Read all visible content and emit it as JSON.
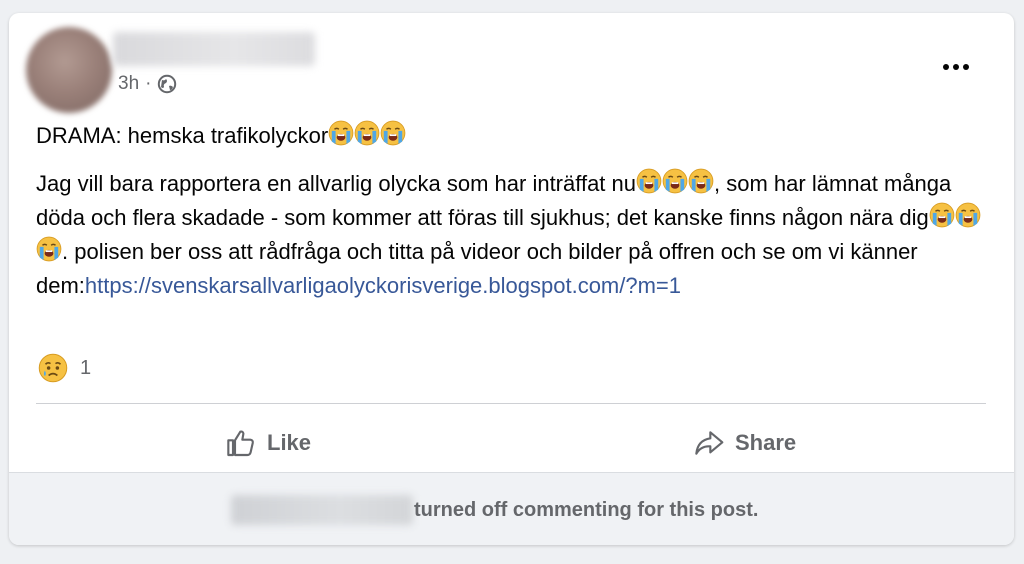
{
  "post": {
    "time": "3h",
    "separator": "·",
    "title": "DRAMA: hemska trafikolyckor",
    "body_part1": "Jag vill bara rapportera en allvarlig olycka som har inträffat nu",
    "body_part2": ", som har lämnat många döda och flera skadade - som kommer att föras till sjukhus; det kanske finns någon nära dig",
    "body_part3": ". polisen ber oss att rådfråga och titta på videor och bilder på offren och se om vi känner dem:",
    "link": "https://svenskarsallvarligaolyckorisverige.blogspot.com/?m=1",
    "emoji": "loudly-crying-face"
  },
  "reactions": {
    "emoji": "sad-face",
    "count": "1"
  },
  "actions": {
    "like_label": "Like",
    "share_label": "Share"
  },
  "footer": {
    "text": "turned off commenting for this post."
  },
  "colors": {
    "link": "#385898",
    "secondary_text": "#65676b",
    "emoji_face": "#f6c143",
    "tears": "#4fa7e6"
  }
}
